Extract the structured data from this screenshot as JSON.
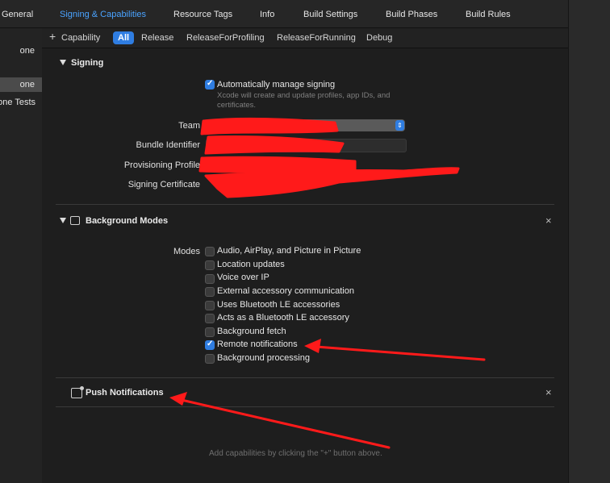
{
  "tabs": [
    "General",
    "Signing & Capabilities",
    "Resource Tags",
    "Info",
    "Build Settings",
    "Build Phases",
    "Build Rules"
  ],
  "active_tab": "Signing & Capabilities",
  "sidebar": {
    "items": [
      "one",
      "one",
      "one Tests"
    ]
  },
  "filters": {
    "add_capability": "Capability",
    "all": "All",
    "items": [
      "Release",
      "ReleaseForProfiling",
      "ReleaseForRunning",
      "Debug"
    ]
  },
  "signing": {
    "title": "Signing",
    "auto_manage": {
      "label": "Automatically manage signing",
      "checked": true
    },
    "hint": "Xcode will create and update profiles, app IDs, and certificates.",
    "labels": {
      "team": "Team",
      "bundle_id": "Bundle Identifier",
      "profile": "Provisioning Profile",
      "certificate": "Signing Certificate"
    }
  },
  "background_modes": {
    "title": "Background Modes",
    "modes_label": "Modes",
    "options": [
      {
        "label": "Audio, AirPlay, and Picture in Picture",
        "checked": false
      },
      {
        "label": "Location updates",
        "checked": false
      },
      {
        "label": "Voice over IP",
        "checked": false
      },
      {
        "label": "External accessory communication",
        "checked": false
      },
      {
        "label": "Uses Bluetooth LE accessories",
        "checked": false
      },
      {
        "label": "Acts as a Bluetooth LE accessory",
        "checked": false
      },
      {
        "label": "Background fetch",
        "checked": false
      },
      {
        "label": "Remote notifications",
        "checked": true
      },
      {
        "label": "Background processing",
        "checked": false
      }
    ]
  },
  "push_notifications": {
    "title": "Push Notifications"
  },
  "footer_hint": "Add capabilities by clicking the \"+\" button above.",
  "colors": {
    "accent": "#2f7de1",
    "annotation": "#ff1a1a",
    "background": "#1e1e1e"
  },
  "icons": {
    "remove": "close-icon",
    "add": "plus-icon",
    "disclosure": "disclosure-triangle-icon"
  }
}
